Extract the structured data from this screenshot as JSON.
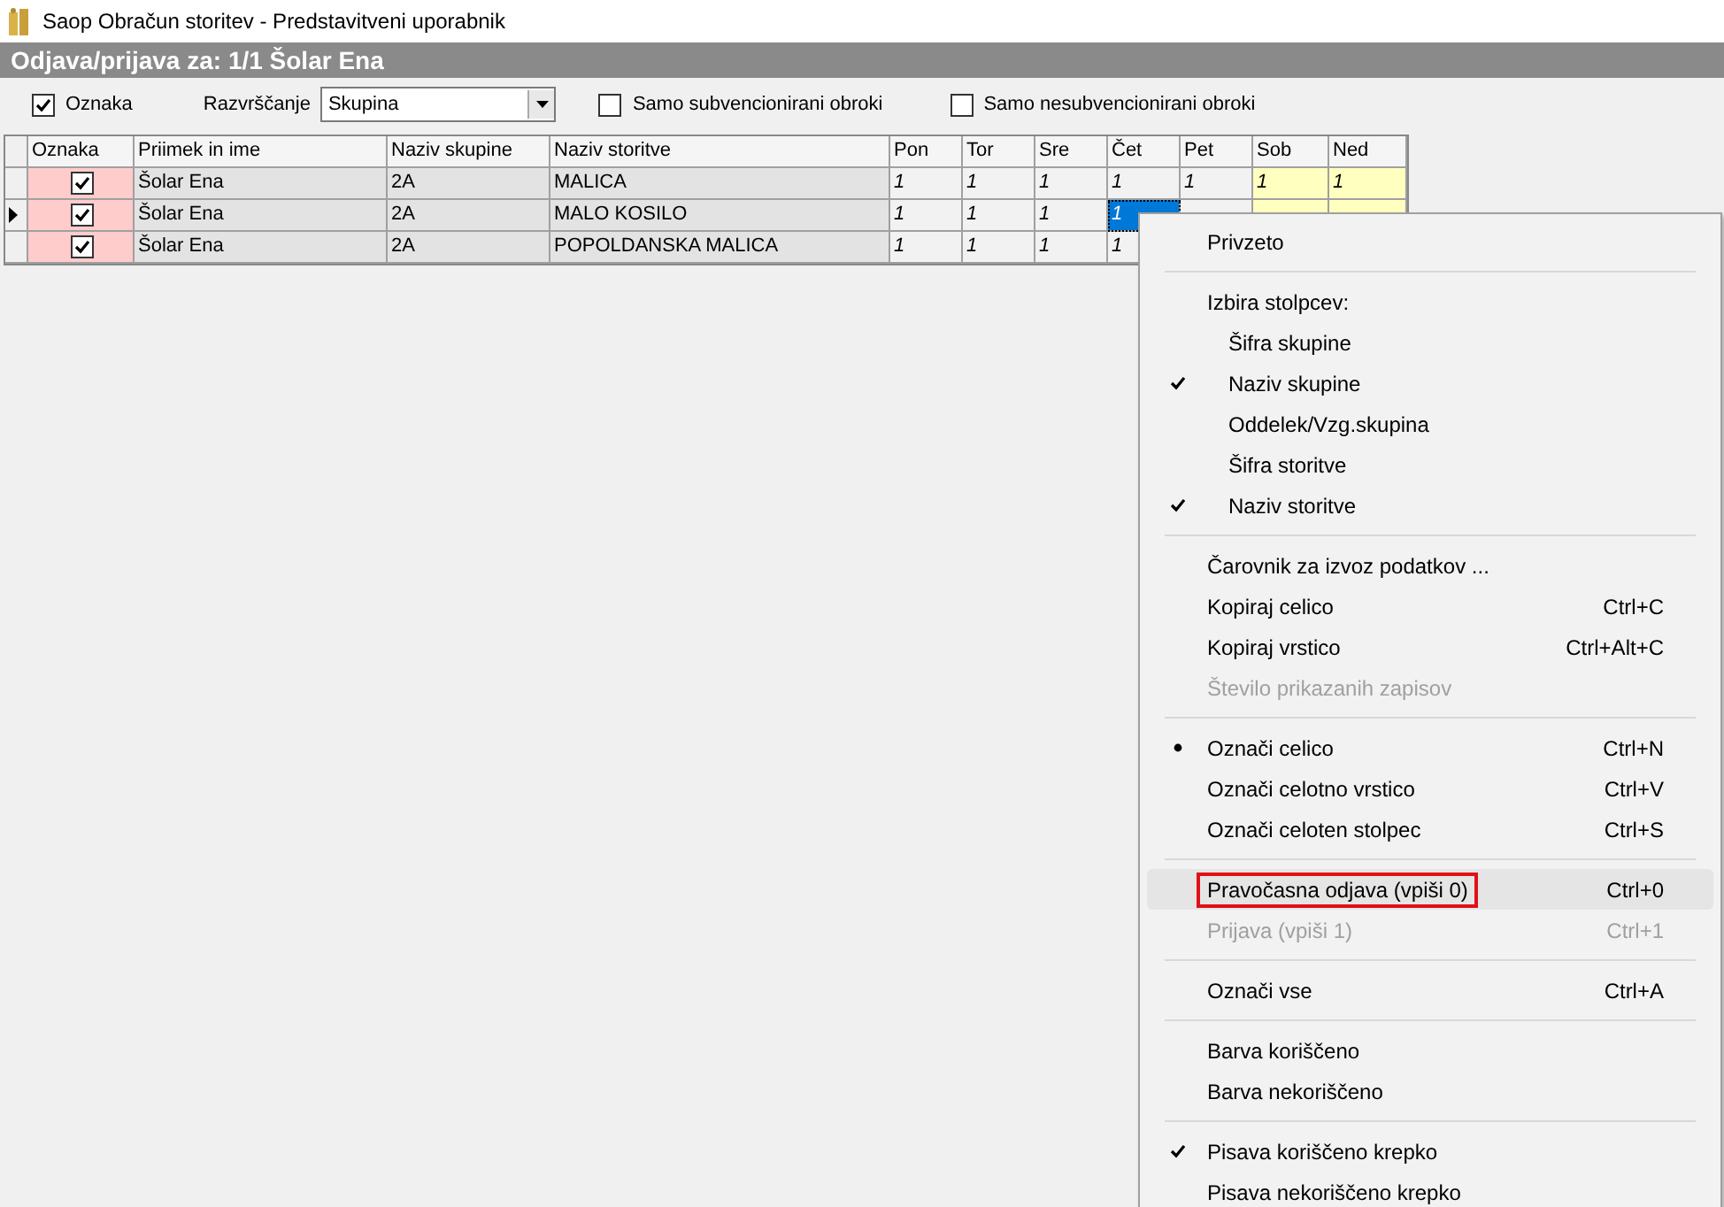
{
  "window": {
    "title": "Saop Obračun storitev - Predstavitveni uporabnik"
  },
  "header": {
    "title": "Odjava/prijava za: 1/1 Šolar Ena"
  },
  "toolbar": {
    "oznaka": {
      "label": "Oznaka",
      "checked": true
    },
    "sort": {
      "label": "Razvrščanje",
      "value": "Skupina"
    },
    "filters": [
      {
        "label": "Samo subvencionirani obroki",
        "checked": false
      },
      {
        "label": "Samo nesubvencionirani obroki",
        "checked": false
      }
    ]
  },
  "table": {
    "columns": [
      "Oznaka",
      "Priimek in ime",
      "Naziv skupine",
      "Naziv storitve",
      "Pon",
      "Tor",
      "Sre",
      "Čet",
      "Pet",
      "Sob",
      "Ned"
    ],
    "rows": [
      {
        "current": false,
        "marked": true,
        "name": "Šolar Ena",
        "group": "2A",
        "service": "MALICA",
        "days": [
          {
            "value": "1",
            "selected": false
          },
          {
            "value": "1",
            "selected": false
          },
          {
            "value": "1",
            "selected": false
          },
          {
            "value": "1",
            "selected": false
          },
          {
            "value": "1",
            "selected": false
          },
          {
            "value": "1",
            "selected": false
          },
          {
            "value": "1",
            "selected": false
          }
        ]
      },
      {
        "current": true,
        "marked": true,
        "name": "Šolar Ena",
        "group": "2A",
        "service": "MALO KOSILO",
        "days": [
          {
            "value": "1",
            "selected": false
          },
          {
            "value": "1",
            "selected": false
          },
          {
            "value": "1",
            "selected": false
          },
          {
            "value": "1",
            "selected": true
          }
        ]
      },
      {
        "current": false,
        "marked": true,
        "name": "Šolar Ena",
        "group": "2A",
        "service": "POPOLDANSKA MALICA",
        "days": [
          {
            "value": "1",
            "selected": false
          },
          {
            "value": "1",
            "selected": false
          },
          {
            "value": "1",
            "selected": false
          },
          {
            "value": "1",
            "selected": false
          }
        ]
      }
    ]
  },
  "context_menu": {
    "items": [
      {
        "kind": "item",
        "label": "Privzeto",
        "disabled": false,
        "selected": false
      },
      {
        "kind": "separator"
      },
      {
        "kind": "header",
        "label": "Izbira stolpcev:"
      },
      {
        "kind": "column",
        "label": "Šifra skupine",
        "checked": false
      },
      {
        "kind": "column",
        "label": "Naziv skupine",
        "checked": true
      },
      {
        "kind": "column",
        "label": "Oddelek/Vzg.skupina",
        "checked": false
      },
      {
        "kind": "column",
        "label": "Šifra storitve",
        "checked": false
      },
      {
        "kind": "column",
        "label": "Naziv storitve",
        "checked": true
      },
      {
        "kind": "separator"
      },
      {
        "kind": "item",
        "label": "Čarovnik za izvoz podatkov ...",
        "disabled": false,
        "selected": false
      },
      {
        "kind": "item",
        "label": "Kopiraj celico",
        "shortcut": "Ctrl+C",
        "disabled": false,
        "selected": false
      },
      {
        "kind": "item",
        "label": "Kopiraj vrstico",
        "shortcut": "Ctrl+Alt+C",
        "disabled": false,
        "selected": false
      },
      {
        "kind": "item",
        "label": "Število prikazanih zapisov",
        "disabled": true,
        "selected": false
      },
      {
        "kind": "separator"
      },
      {
        "kind": "radio",
        "label": "Označi celico",
        "shortcut": "Ctrl+N",
        "checked": true
      },
      {
        "kind": "radio",
        "label": "Označi celotno vrstico",
        "shortcut": "Ctrl+V",
        "checked": false
      },
      {
        "kind": "radio",
        "label": "Označi celoten stolpec",
        "shortcut": "Ctrl+S",
        "checked": false
      },
      {
        "kind": "separator"
      },
      {
        "kind": "item",
        "label": "Pravočasna odjava (vpiši 0)",
        "shortcut": "Ctrl+0",
        "disabled": false,
        "selected": true,
        "outlined": true
      },
      {
        "kind": "item",
        "label": "Prijava (vpiši 1)",
        "shortcut": "Ctrl+1",
        "disabled": true,
        "selected": false
      },
      {
        "kind": "separator"
      },
      {
        "kind": "item",
        "label": "Označi vse",
        "shortcut": "Ctrl+A",
        "disabled": false,
        "selected": false
      },
      {
        "kind": "separator"
      },
      {
        "kind": "item",
        "label": "Barva koriščeno",
        "disabled": false,
        "selected": false
      },
      {
        "kind": "item",
        "label": "Barva nekoriščeno",
        "disabled": false,
        "selected": false
      },
      {
        "kind": "separator"
      },
      {
        "kind": "toggle",
        "label": "Pisava koriščeno krepko",
        "checked": true
      },
      {
        "kind": "toggle",
        "label": "Pisava nekoriščeno krepko",
        "checked": false
      }
    ]
  }
}
